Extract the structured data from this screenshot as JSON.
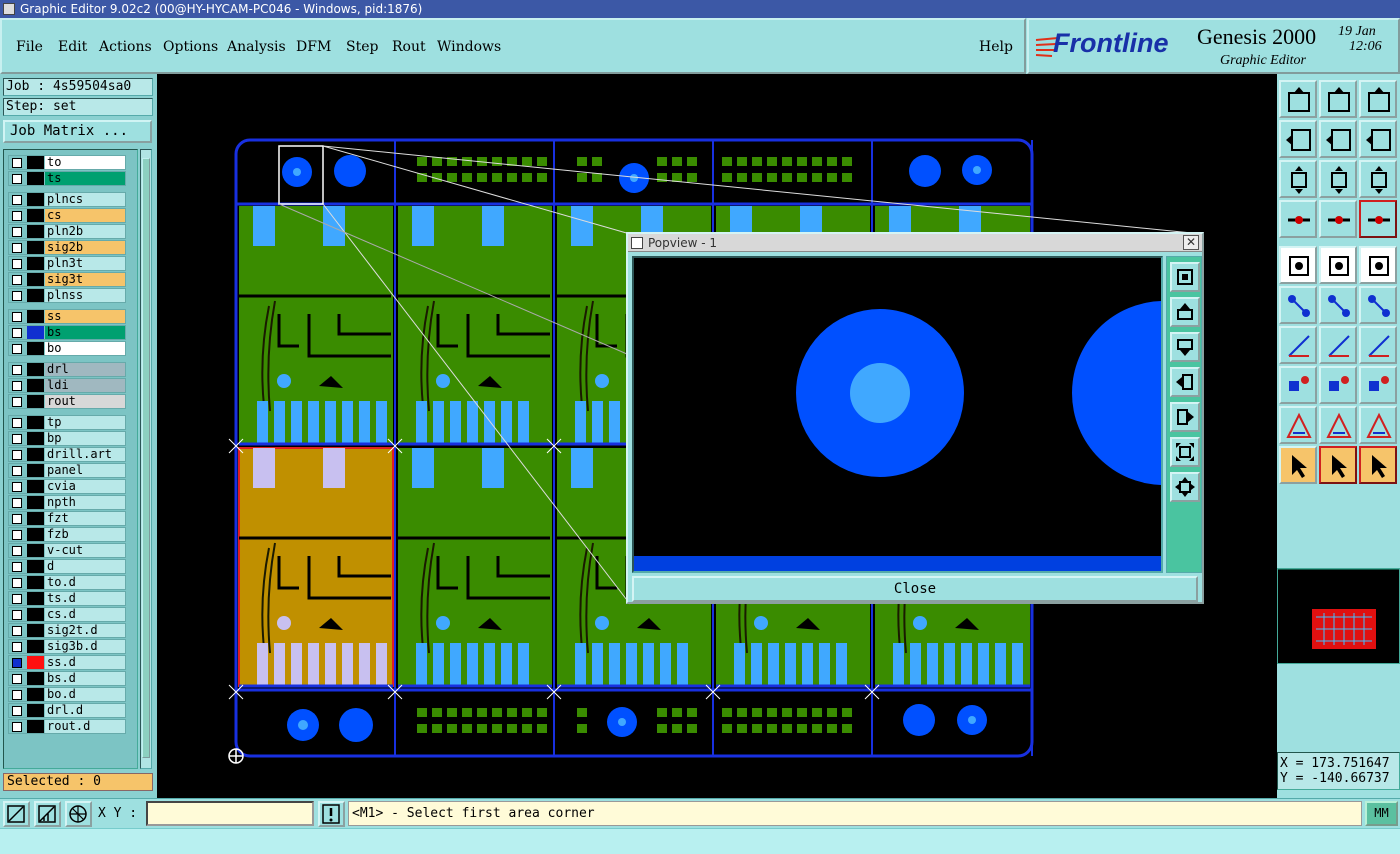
{
  "window": {
    "title": "Graphic Editor 9.02c2 (00@HY-HYCAM-PC046 - Windows, pid:1876)"
  },
  "menu": {
    "items": [
      "File",
      "Edit",
      "Actions",
      "Options",
      "Analysis",
      "DFM",
      "Step",
      "Rout",
      "Windows"
    ],
    "help": "Help"
  },
  "brand": {
    "logo": "Frontline",
    "product": "Genesis 2000",
    "module": "Graphic Editor",
    "date": "19 Jan",
    "time": "12:06"
  },
  "job": {
    "job_line": "Job : 4s59504sa0",
    "step_line": "Step: set",
    "matrix_button": "Job Matrix ..."
  },
  "layers": [
    {
      "name": "to",
      "color": "#ffffff"
    },
    {
      "name": "ts",
      "color": "#00a070"
    },
    {
      "name": "plncs",
      "color": "#b8e8e8"
    },
    {
      "name": "cs",
      "color": "#f6c46a"
    },
    {
      "name": "pln2b",
      "color": "#b8e8e8"
    },
    {
      "name": "sig2b",
      "color": "#f6c46a"
    },
    {
      "name": "pln3t",
      "color": "#b8e8e8"
    },
    {
      "name": "sig3t",
      "color": "#f6c46a"
    },
    {
      "name": "plnss",
      "color": "#b8e8e8"
    },
    {
      "name": "ss",
      "color": "#f6c46a"
    },
    {
      "name": "bs",
      "color": "#00a070"
    },
    {
      "name": "bo",
      "color": "#ffffff"
    },
    {
      "name": "drl",
      "color": "#a0b8c0"
    },
    {
      "name": "ldi",
      "color": "#a0b8c0"
    },
    {
      "name": "rout",
      "color": "#d8d8d8"
    },
    {
      "name": "tp",
      "color": "#b8e8e8"
    },
    {
      "name": "bp",
      "color": "#b8e8e8"
    },
    {
      "name": "drill.art",
      "color": "#b8e8e8"
    },
    {
      "name": "panel",
      "color": "#b8e8e8"
    },
    {
      "name": "cvia",
      "color": "#b8e8e8"
    },
    {
      "name": "npth",
      "color": "#b8e8e8"
    },
    {
      "name": "fzt",
      "color": "#b8e8e8"
    },
    {
      "name": "fzb",
      "color": "#b8e8e8"
    },
    {
      "name": "v-cut",
      "color": "#b8e8e8"
    },
    {
      "name": "d",
      "color": "#b8e8e8"
    },
    {
      "name": "to.d",
      "color": "#b8e8e8"
    },
    {
      "name": "ts.d",
      "color": "#b8e8e8"
    },
    {
      "name": "cs.d",
      "color": "#b8e8e8"
    },
    {
      "name": "sig2t.d",
      "color": "#b8e8e8"
    },
    {
      "name": "sig3b.d",
      "color": "#b8e8e8"
    },
    {
      "name": "ss.d",
      "color": "#b8e8e8"
    },
    {
      "name": "bs.d",
      "color": "#b8e8e8"
    },
    {
      "name": "bo.d",
      "color": "#b8e8e8"
    },
    {
      "name": "drl.d",
      "color": "#b8e8e8"
    },
    {
      "name": "rout.d",
      "color": "#b8e8e8"
    }
  ],
  "selected_text": "Selected : 0",
  "coords": {
    "x": "X = 173.751647",
    "y": "Y = -140.66737"
  },
  "bottom": {
    "xy_label": "X Y :",
    "xy_value": "",
    "message": "<M1> - Select first area corner",
    "units": "MM"
  },
  "popview": {
    "title": "Popview - 1",
    "close_label": "Close"
  },
  "colors": {
    "board_green": "#3a8c00",
    "pad_blue": "#0050ff",
    "pad_cyan": "#40a8ff",
    "selected_step": "#c09000",
    "outline": "#1830e0"
  }
}
